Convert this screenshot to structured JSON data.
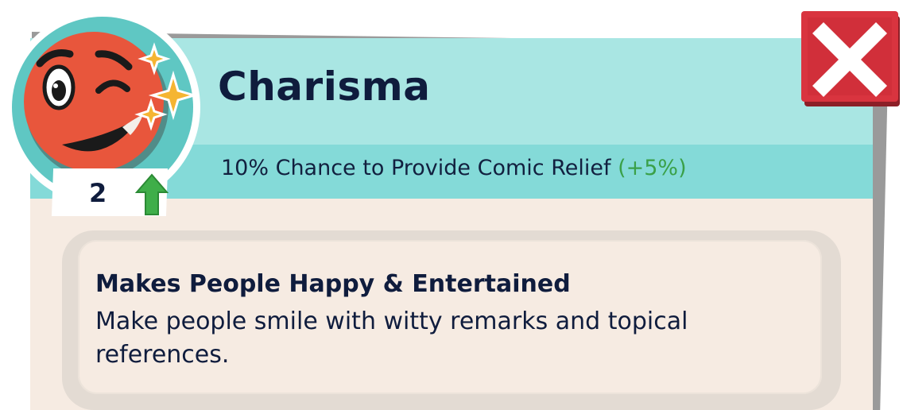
{
  "skill": {
    "title": "Charisma",
    "level": "2",
    "level_up_icon": "green-up-arrow-icon",
    "portrait_icon": "winking-face-with-sparkles-icon"
  },
  "stat": {
    "text": "10% Chance to Provide Comic Relief",
    "bonus": "(+5%)"
  },
  "description": {
    "heading": "Makes People Happy & Entertained",
    "body": "Make people smile with witty remarks and topical references."
  },
  "close_button": {
    "icon": "close-x-icon"
  },
  "colors": {
    "header": "#a9e6e3",
    "stat_band": "#84dad8",
    "panel": "#f6ebe2",
    "title_text": "#0f1c3d",
    "bonus_text": "#3aa048",
    "close_red": "#d9343f",
    "face": "#e8563c"
  }
}
